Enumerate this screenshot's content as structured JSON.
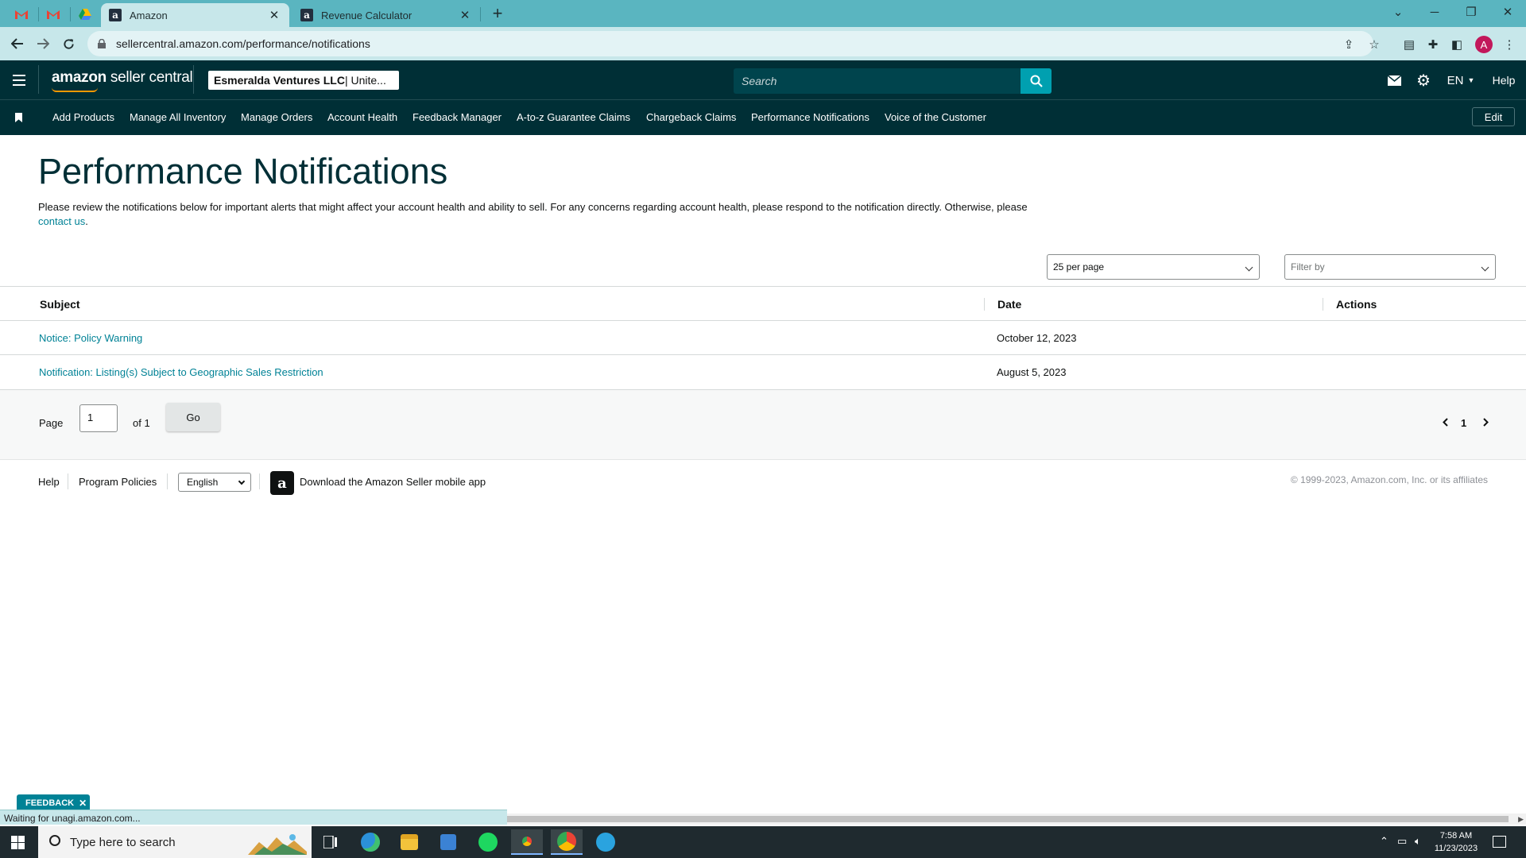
{
  "browser": {
    "tabs": [
      {
        "title": "Amazon",
        "favicon": "amazon-a"
      },
      {
        "title": "Revenue Calculator",
        "favicon": "amazon-a"
      }
    ],
    "pinned_tabs": [
      "gmail-icon",
      "gmail-icon",
      "drive-icon"
    ],
    "url": "sellercentral.amazon.com/performance/notifications",
    "profile_initial": "A",
    "status_text": "Waiting for unagi.amazon.com..."
  },
  "header": {
    "logo_brand": "amazon",
    "logo_suffix": " seller central",
    "account_name": "Esmeralda Ventures LLC",
    "account_region": " | Unite...",
    "search_placeholder": "Search",
    "language": "EN",
    "help_label": "Help"
  },
  "nav": {
    "items": [
      "Add Products",
      "Manage All Inventory",
      "Manage Orders",
      "Account Health",
      "Feedback Manager",
      "A-to-z Guarantee Claims",
      "Chargeback Claims",
      "Performance Notifications",
      "Voice of the Customer"
    ],
    "edit_label": "Edit"
  },
  "main": {
    "title": "Performance Notifications",
    "description_text": "Please review the notifications below for important alerts that might affect your account health and ability to sell. For any concerns regarding account health, please respond to the notification directly. Otherwise, please ",
    "description_link": "contact us",
    "description_end": ".",
    "per_page": "25 per page",
    "filter_placeholder": "Filter by"
  },
  "table": {
    "columns": [
      "Subject",
      "Date",
      "Actions"
    ],
    "rows": [
      {
        "subject": "Notice: Policy Warning",
        "date": "October 12, 2023",
        "actions": ""
      },
      {
        "subject": "Notification: Listing(s) Subject to Geographic Sales Restriction",
        "date": "August 5, 2023",
        "actions": ""
      }
    ]
  },
  "pagination": {
    "page_label": "Page",
    "page_value": "1",
    "of_label": "of 1",
    "go_label": "Go",
    "current_page": "1"
  },
  "footer": {
    "help": "Help",
    "program_policies": "Program Policies",
    "language": "English",
    "app_download": "Download the Amazon Seller mobile app",
    "copyright": "© 1999-2023, Amazon.com, Inc. or its affiliates"
  },
  "feedback_tab": "FEEDBACK",
  "taskbar": {
    "search_placeholder": "Type here to search",
    "time": "7:58 AM",
    "date": "11/23/2023"
  },
  "colors": {
    "header_bg": "#002f36",
    "link": "#008296",
    "search_button": "#00a0b0",
    "browser_tabstrip": "#5ab5c0"
  }
}
